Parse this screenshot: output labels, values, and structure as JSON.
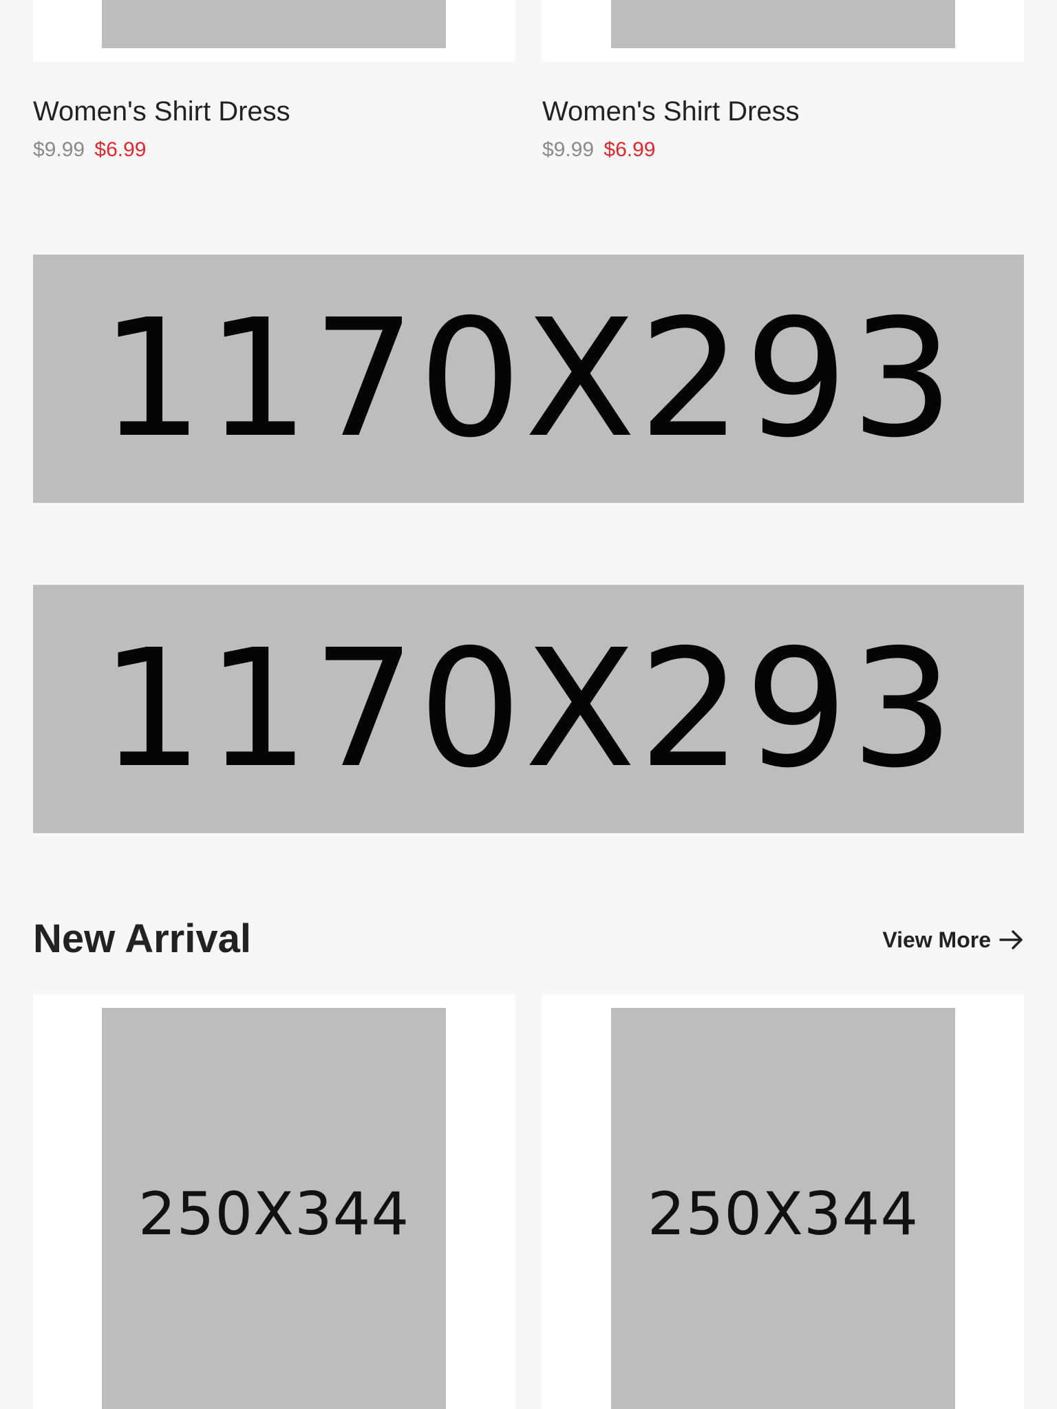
{
  "top_products": [
    {
      "name": "Women's Shirt Dress",
      "old_price": "$9.99",
      "new_price": "$6.99"
    },
    {
      "name": "Women's Shirt Dress",
      "old_price": "$9.99",
      "new_price": "$6.99"
    }
  ],
  "banners": [
    {
      "label": "1170X293"
    },
    {
      "label": "1170X293"
    }
  ],
  "new_arrival": {
    "title": "New Arrival",
    "view_more": "View More",
    "items": [
      {
        "image_label": "250X344"
      },
      {
        "image_label": "250X344"
      }
    ]
  },
  "colors": {
    "background": "#f7f7f7",
    "placeholder": "#bdbdbd",
    "sale_price": "#e0282e",
    "old_price": "#8a8a8a"
  },
  "icons": {
    "view_more": "arrow-right-icon"
  }
}
